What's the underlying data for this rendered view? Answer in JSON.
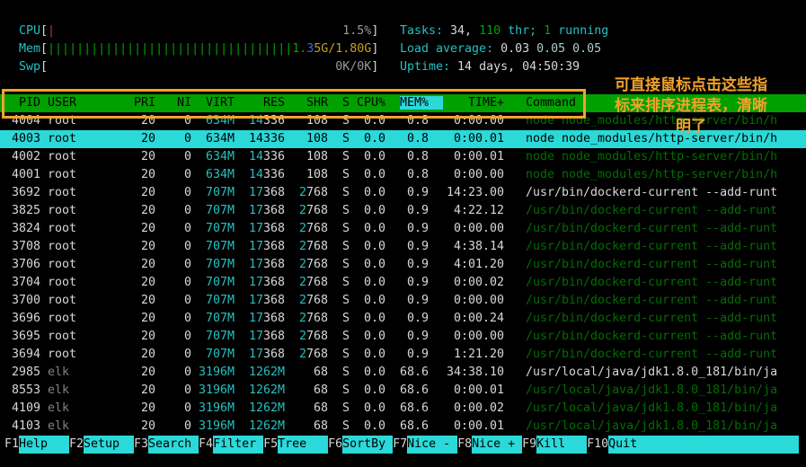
{
  "colors": {
    "white": "#d8d8d8",
    "cyan": "#25c0c0",
    "green": "#00a400",
    "dgreen": "#006e00",
    "gray": "#9a9a9a",
    "dim": "#828282",
    "red": "#c03a3a",
    "blue": "#4a6cd4",
    "yellow": "#c4a028",
    "pale": "#aecaca",
    "orange": "#f2a32a",
    "sel_bg": "#2bd9d9",
    "header_bg": "#00a000",
    "bg": "#000000"
  },
  "meters": [
    {
      "name": "cpu-meter",
      "label": "CPU",
      "bars": 1,
      "bar_color": "red",
      "value": [
        [
          "1.5%",
          "gray"
        ]
      ]
    },
    {
      "name": "mem-meter",
      "label": "Mem",
      "bars": 34,
      "bar_color": "green",
      "value": [
        [
          "1.",
          "green"
        ],
        [
          "3",
          "blue"
        ],
        [
          "5G/1.80G",
          "yellow"
        ]
      ]
    },
    {
      "name": "swp-meter",
      "label": "Swp",
      "bars": 0,
      "bar_color": "green",
      "value": [
        [
          "0K/0K",
          "gray"
        ]
      ]
    }
  ],
  "info": [
    {
      "name": "tasks-summary",
      "segments": [
        [
          "Tasks: ",
          "cyan"
        ],
        [
          "34, ",
          "white"
        ],
        [
          "110",
          "green"
        ],
        [
          " thr",
          "cyan"
        ],
        [
          "; ",
          "cyan"
        ],
        [
          "1",
          "green"
        ],
        [
          " running",
          "cyan"
        ]
      ]
    },
    {
      "name": "load-average",
      "segments": [
        [
          "Load average: ",
          "cyan"
        ],
        [
          "0.03 ",
          "white"
        ],
        [
          "0.05 0.05",
          "pale"
        ]
      ]
    },
    {
      "name": "uptime",
      "segments": [
        [
          "Uptime: ",
          "cyan"
        ],
        [
          "14 days, 04:50:39",
          "white"
        ]
      ]
    }
  ],
  "table": {
    "headers": {
      "pid": "PID",
      "user": "USER",
      "pri": "PRI",
      "ni": "NI",
      "virt": "VIRT",
      "res": "RES",
      "shr": "SHR",
      "s": "S",
      "cpu": "CPU%",
      "mem": "MEM%",
      "time": "TIME+",
      "cmd": "Command"
    },
    "sort_column": "mem",
    "rows": [
      {
        "pid": "4004",
        "user": "root",
        "pri": "20",
        "ni": "0",
        "virt": "634M",
        "res": "14336",
        "shr": "108",
        "s": "S",
        "cpu": "0.0",
        "mem": "0.8",
        "time": "0:00.00",
        "cmd": "node node_modules/http-server/bin/h",
        "cmd_style": "thread",
        "user_style": "self",
        "selected": false
      },
      {
        "pid": "4003",
        "user": "root",
        "pri": "20",
        "ni": "0",
        "virt": "634M",
        "res": "14336",
        "shr": "108",
        "s": "S",
        "cpu": "0.0",
        "mem": "0.8",
        "time": "0:00.01",
        "cmd": "node node_modules/http-server/bin/h",
        "cmd_style": "thread",
        "user_style": "self",
        "selected": true
      },
      {
        "pid": "4002",
        "user": "root",
        "pri": "20",
        "ni": "0",
        "virt": "634M",
        "res": "14336",
        "shr": "108",
        "s": "S",
        "cpu": "0.0",
        "mem": "0.8",
        "time": "0:00.01",
        "cmd": "node node_modules/http-server/bin/h",
        "cmd_style": "thread",
        "user_style": "self",
        "selected": false
      },
      {
        "pid": "4001",
        "user": "root",
        "pri": "20",
        "ni": "0",
        "virt": "634M",
        "res": "14336",
        "shr": "108",
        "s": "S",
        "cpu": "0.0",
        "mem": "0.8",
        "time": "0:00.00",
        "cmd": "node node_modules/http-server/bin/h",
        "cmd_style": "thread",
        "user_style": "self",
        "selected": false
      },
      {
        "pid": "3692",
        "user": "root",
        "pri": "20",
        "ni": "0",
        "virt": "707M",
        "res": "17368",
        "shr": "2768",
        "s": "S",
        "cpu": "0.0",
        "mem": "0.9",
        "time": "14:23.00",
        "cmd": "/usr/bin/dockerd-current --add-runt",
        "cmd_style": "normal",
        "user_style": "self",
        "selected": false
      },
      {
        "pid": "3825",
        "user": "root",
        "pri": "20",
        "ni": "0",
        "virt": "707M",
        "res": "17368",
        "shr": "2768",
        "s": "S",
        "cpu": "0.0",
        "mem": "0.9",
        "time": "4:22.12",
        "cmd": "/usr/bin/dockerd-current --add-runt",
        "cmd_style": "thread",
        "user_style": "self",
        "selected": false
      },
      {
        "pid": "3824",
        "user": "root",
        "pri": "20",
        "ni": "0",
        "virt": "707M",
        "res": "17368",
        "shr": "2768",
        "s": "S",
        "cpu": "0.0",
        "mem": "0.9",
        "time": "0:00.00",
        "cmd": "/usr/bin/dockerd-current --add-runt",
        "cmd_style": "thread",
        "user_style": "self",
        "selected": false
      },
      {
        "pid": "3708",
        "user": "root",
        "pri": "20",
        "ni": "0",
        "virt": "707M",
        "res": "17368",
        "shr": "2768",
        "s": "S",
        "cpu": "0.0",
        "mem": "0.9",
        "time": "4:38.14",
        "cmd": "/usr/bin/dockerd-current --add-runt",
        "cmd_style": "thread",
        "user_style": "self",
        "selected": false
      },
      {
        "pid": "3706",
        "user": "root",
        "pri": "20",
        "ni": "0",
        "virt": "707M",
        "res": "17368",
        "shr": "2768",
        "s": "S",
        "cpu": "0.0",
        "mem": "0.9",
        "time": "4:01.20",
        "cmd": "/usr/bin/dockerd-current --add-runt",
        "cmd_style": "thread",
        "user_style": "self",
        "selected": false
      },
      {
        "pid": "3704",
        "user": "root",
        "pri": "20",
        "ni": "0",
        "virt": "707M",
        "res": "17368",
        "shr": "2768",
        "s": "S",
        "cpu": "0.0",
        "mem": "0.9",
        "time": "0:00.02",
        "cmd": "/usr/bin/dockerd-current --add-runt",
        "cmd_style": "thread",
        "user_style": "self",
        "selected": false
      },
      {
        "pid": "3700",
        "user": "root",
        "pri": "20",
        "ni": "0",
        "virt": "707M",
        "res": "17368",
        "shr": "2768",
        "s": "S",
        "cpu": "0.0",
        "mem": "0.9",
        "time": "0:00.00",
        "cmd": "/usr/bin/dockerd-current --add-runt",
        "cmd_style": "thread",
        "user_style": "self",
        "selected": false
      },
      {
        "pid": "3696",
        "user": "root",
        "pri": "20",
        "ni": "0",
        "virt": "707M",
        "res": "17368",
        "shr": "2768",
        "s": "S",
        "cpu": "0.0",
        "mem": "0.9",
        "time": "0:00.24",
        "cmd": "/usr/bin/dockerd-current --add-runt",
        "cmd_style": "thread",
        "user_style": "self",
        "selected": false
      },
      {
        "pid": "3695",
        "user": "root",
        "pri": "20",
        "ni": "0",
        "virt": "707M",
        "res": "17368",
        "shr": "2768",
        "s": "S",
        "cpu": "0.0",
        "mem": "0.9",
        "time": "0:00.00",
        "cmd": "/usr/bin/dockerd-current --add-runt",
        "cmd_style": "thread",
        "user_style": "self",
        "selected": false
      },
      {
        "pid": "3694",
        "user": "root",
        "pri": "20",
        "ni": "0",
        "virt": "707M",
        "res": "17368",
        "shr": "2768",
        "s": "S",
        "cpu": "0.0",
        "mem": "0.9",
        "time": "1:21.20",
        "cmd": "/usr/bin/dockerd-current --add-runt",
        "cmd_style": "thread",
        "user_style": "self",
        "selected": false
      },
      {
        "pid": "2985",
        "user": "elk",
        "pri": "20",
        "ni": "0",
        "virt": "3196M",
        "res": "1262M",
        "shr": "68",
        "s": "S",
        "cpu": "0.0",
        "mem": "68.6",
        "time": "34:38.10",
        "cmd": "/usr/local/java/jdk1.8.0_181/bin/ja",
        "cmd_style": "normal",
        "user_style": "other",
        "selected": false
      },
      {
        "pid": "8553",
        "user": "elk",
        "pri": "20",
        "ni": "0",
        "virt": "3196M",
        "res": "1262M",
        "shr": "68",
        "s": "S",
        "cpu": "0.0",
        "mem": "68.6",
        "time": "0:00.01",
        "cmd": "/usr/local/java/jdk1.8.0_181/bin/ja",
        "cmd_style": "thread",
        "user_style": "other",
        "selected": false
      },
      {
        "pid": "4109",
        "user": "elk",
        "pri": "20",
        "ni": "0",
        "virt": "3196M",
        "res": "1262M",
        "shr": "68",
        "s": "S",
        "cpu": "0.0",
        "mem": "68.6",
        "time": "0:00.02",
        "cmd": "/usr/local/java/jdk1.8.0_181/bin/ja",
        "cmd_style": "thread",
        "user_style": "other",
        "selected": false
      },
      {
        "pid": "4103",
        "user": "elk",
        "pri": "20",
        "ni": "0",
        "virt": "3196M",
        "res": "1262M",
        "shr": "68",
        "s": "S",
        "cpu": "0.0",
        "mem": "68.6",
        "time": "0:00.01",
        "cmd": "/usr/local/java/jdk1.8.0_181/bin/ja",
        "cmd_style": "thread",
        "user_style": "other",
        "selected": false
      }
    ]
  },
  "fkeys": [
    {
      "key": "F1",
      "label": "Help"
    },
    {
      "key": "F2",
      "label": "Setup"
    },
    {
      "key": "F3",
      "label": "Search"
    },
    {
      "key": "F4",
      "label": "Filter"
    },
    {
      "key": "F5",
      "label": "Tree"
    },
    {
      "key": "F6",
      "label": "SortBy"
    },
    {
      "key": "F7",
      "label": "Nice -"
    },
    {
      "key": "F8",
      "label": "Nice +"
    },
    {
      "key": "F9",
      "label": "Kill"
    },
    {
      "key": "F10",
      "label": "Quit"
    }
  ],
  "annotation": {
    "lines": [
      "可直接鼠标点击这些指",
      "标来排序进程表，清晰",
      "明了"
    ]
  }
}
